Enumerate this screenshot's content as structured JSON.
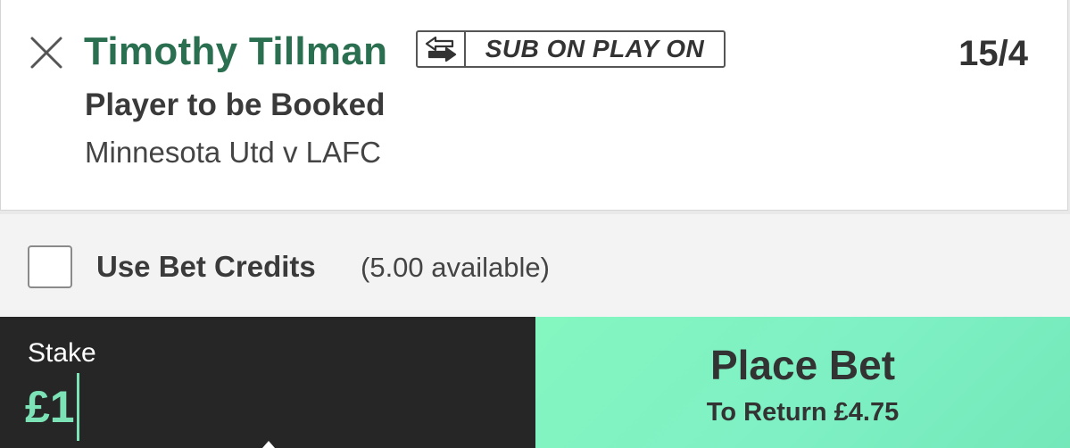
{
  "selection": {
    "player_name": "Timothy Tillman",
    "sub_badge_label": "SUB ON PLAY ON",
    "odds": "15/4",
    "market": "Player to be Booked",
    "event": "Minnesota Utd v LAFC",
    "remove_icon": "close-icon",
    "sub_icon": "swap-arrows-icon"
  },
  "bet_credits": {
    "label": "Use Bet Credits",
    "available": "(5.00 available)",
    "checked": false
  },
  "stake": {
    "label": "Stake",
    "value": "£1"
  },
  "place_bet": {
    "label": "Place Bet",
    "to_return": "To Return £4.75"
  },
  "colors": {
    "player_name": "#2a6f4f",
    "stake_value": "#7be3b5",
    "stake_panel": "#262626",
    "place_bet": "#7ef0c4",
    "text_dark": "#333333"
  }
}
